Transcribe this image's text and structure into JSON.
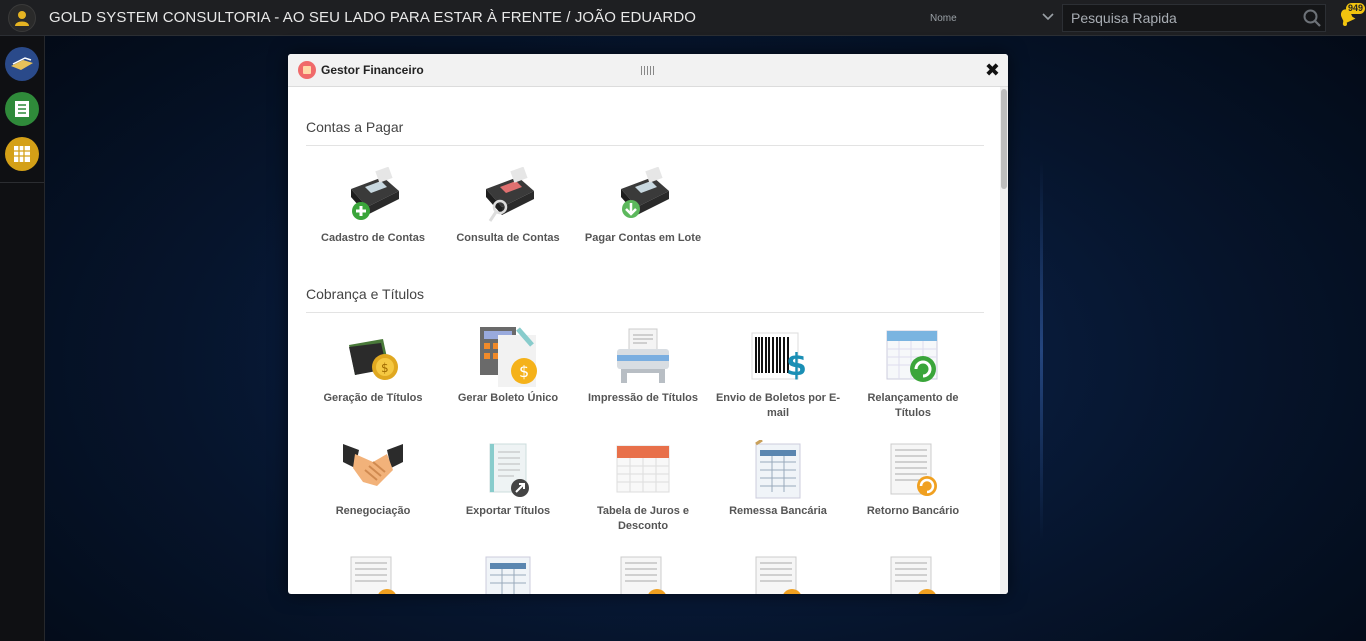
{
  "app": {
    "title": "GOLD SYSTEM CONSULTORIA - AO SEU LADO PARA ESTAR À FRENTE / JOÃO EDUARDO"
  },
  "search": {
    "filter_value": "Nome",
    "placeholder": "Pesquisa Rapida"
  },
  "notifications": {
    "count": "949"
  },
  "modal": {
    "title": "Gestor Financeiro",
    "sections": [
      {
        "title": "Contas a Pagar",
        "items": [
          {
            "label": "Cadastro de Contas",
            "icon": "card-terminal-add-icon"
          },
          {
            "label": "Consulta de Contas",
            "icon": "card-terminal-search-icon"
          },
          {
            "label": "Pagar Contas em Lote",
            "icon": "card-terminal-download-icon"
          }
        ]
      },
      {
        "title": "Cobrança e Títulos",
        "items": [
          {
            "label": "Geração de Títulos",
            "icon": "wallet-coin-icon"
          },
          {
            "label": "Gerar Boleto Único",
            "icon": "calculator-dollar-icon"
          },
          {
            "label": "Impressão de Títulos",
            "icon": "printer-icon"
          },
          {
            "label": "Envio de Boletos por E-mail",
            "icon": "barcode-dollar-icon"
          },
          {
            "label": "Relançamento de Títulos",
            "icon": "calendar-refresh-icon"
          },
          {
            "label": "Renegociação",
            "icon": "handshake-icon"
          },
          {
            "label": "Exportar Títulos",
            "icon": "document-export-icon"
          },
          {
            "label": "Tabela de Juros e Desconto",
            "icon": "calendar-icon"
          },
          {
            "label": "Remessa Bancária",
            "icon": "spreadsheet-clip-icon"
          },
          {
            "label": "Retorno Bancário",
            "icon": "document-return-icon"
          }
        ]
      }
    ]
  },
  "colors": {
    "topbar": "#1e1f22",
    "sidebar": "#0f1013",
    "background": "#06142b",
    "accent_gold": "#f1c40f"
  }
}
